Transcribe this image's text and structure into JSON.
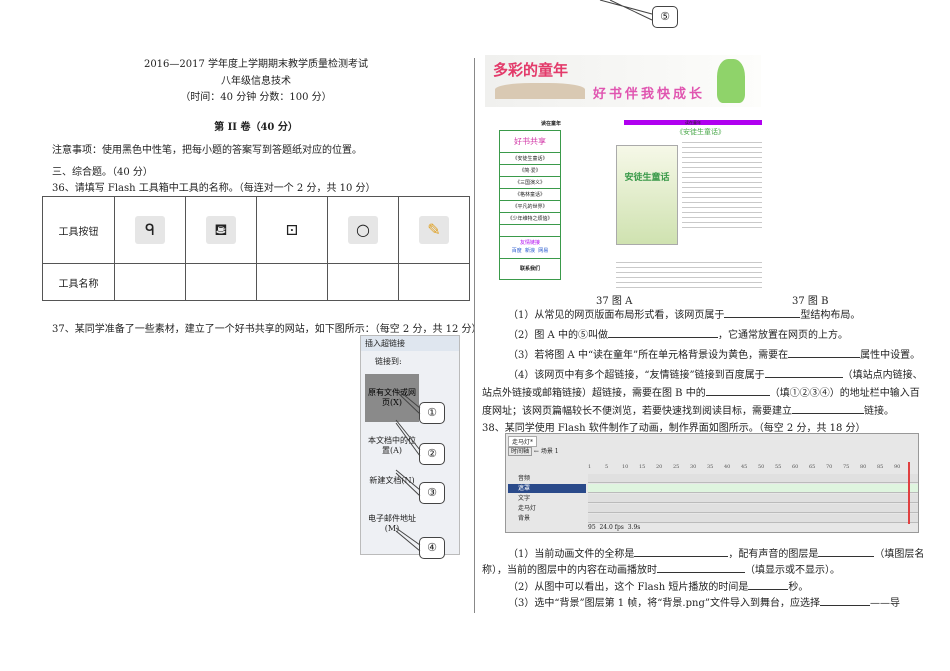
{
  "header": {
    "title": "2016—2017 学年度上学期期末教学质量检测考试",
    "subject": "八年级信息技术",
    "meta": "（时间：40 分钟      分数：100 分）",
    "section": "第 II 卷（40 分）"
  },
  "notice": "注意事项：使用黑色中性笔，把每小题的答案写到答题纸对应的位置。",
  "part": "三、综合题。（40 分）",
  "q36": {
    "text": "36、请填写 Flash 工具箱中工具的名称。（每连对一个 2 分，共 10 分）",
    "row1": "工具按钮",
    "row2": "工具名称",
    "tools": [
      "lasso-tool",
      "ink-bottle-tool",
      "free-transform-tool",
      "oval-tool",
      "pencil-tool"
    ]
  },
  "q37": {
    "text": "37、某同学准备了一些素材，建立了一个好书共享的网站，如下图所示：（每空 2 分，共 12 分）",
    "figA_label": "37 图 A",
    "figB_label": "37 图 B",
    "banner": {
      "title": "多彩的童年",
      "slogan": "好书伴我快成长"
    },
    "nav": {
      "heading": "读在童年",
      "title": "好书共享",
      "items": [
        "《安徒生童话》",
        "《简·爱》",
        "《三国演义》",
        "《格林童话》",
        "《平凡的世界》",
        "《少年维特之烦恼》"
      ],
      "friends": "友情链接",
      "links": [
        "百度",
        "新浪",
        "网易"
      ],
      "contact": "联系我们"
    },
    "article": {
      "bar": "读在童年",
      "title": "《安徒生童话》",
      "cover": "安徒生童话"
    },
    "dialog": {
      "title": "插入超链接",
      "link_to": "链接到:",
      "items": [
        "原有文件或网页(X)",
        "本文档中的位置(A)",
        "新建文档(N)",
        "电子邮件地址(M)"
      ]
    },
    "callouts": [
      "①",
      "②",
      "③",
      "④",
      "⑤"
    ],
    "questions": [
      "（1）从常见的网页版面布局形式看，该网页属于",
      "型结构布局。",
      "（2）图 A 中的⑤叫做",
      "，它通常放置在网页的上方。",
      "（3）若将图 A 中“读在童年”所在单元格背景设为黄色，需要在",
      "属性中设置。",
      "（4）该网页中有多个超链接，“友情链接”链接到百度属于",
      "（填站点内链接、",
      "站点外链接或邮箱链接）超链接，需要在图 B 中的",
      "（填①②③④）的地址栏中输入百",
      "度网址；该网页篇幅较长不便浏览，若要快速找到阅读目标，需要建立",
      "链接。"
    ]
  },
  "q38": {
    "text": "38、某同学使用 Flash 软件制作了动画，制作界面如图所示。（每空 2 分，共 18 分）",
    "flash": {
      "tab": "走马灯*",
      "back": "时间轴",
      "scene": "场景 1",
      "ruler": [
        "1",
        "5",
        "10",
        "15",
        "20",
        "25",
        "30",
        "35",
        "40",
        "45",
        "50",
        "55",
        "60",
        "65",
        "70",
        "75",
        "80",
        "85",
        "90"
      ],
      "layers": [
        "音频",
        "遮罩",
        "文字",
        "走马灯",
        "背景"
      ],
      "frame": "95",
      "fps": "24.0 fps",
      "time": "3.9s"
    },
    "questions": [
      "（1）当前动画文件的全称是",
      "，配有声音的图层是",
      "（填图层名",
      "称），当前的图层中的内容在动画播放时",
      "（填显示或不显示）。",
      "（2）从图中可以看出，这个 Flash 短片播放的时间是",
      "秒。",
      "（3）选中“背景”图层第 1 帧，将“背景.png”文件导入到舞台，应选择",
      "——导"
    ]
  }
}
